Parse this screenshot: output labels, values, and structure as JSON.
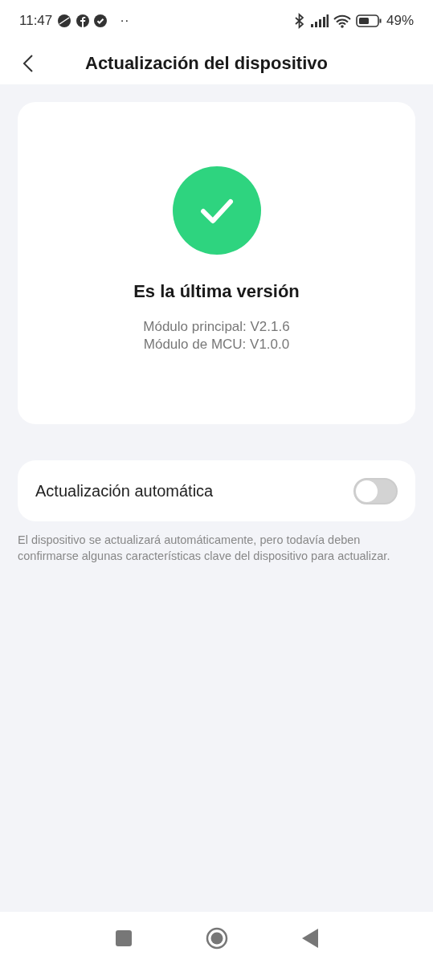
{
  "status_bar": {
    "time": "11:47",
    "more": "··",
    "battery_percent": "49%"
  },
  "header": {
    "title": "Actualización del dispositivo"
  },
  "update_card": {
    "status": "Es la última versión",
    "versions": [
      "Módulo principal: V2.1.6",
      "Módulo de MCU: V1.0.0"
    ]
  },
  "auto_update": {
    "label": "Actualización automática",
    "on": false
  },
  "footnote": "El dispositivo se actualizará automáticamente, pero todavía deben confirmarse algunas características clave del dispositivo para actualizar."
}
